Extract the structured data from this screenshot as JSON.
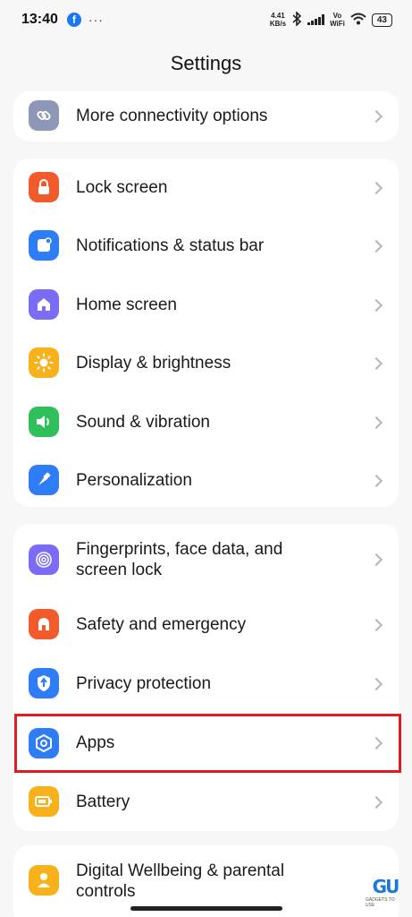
{
  "status_bar": {
    "time": "13:40",
    "fb_glyph": "f",
    "dots": "···",
    "speed_value": "4.41",
    "speed_unit": "KB/s",
    "vo": "Vo",
    "wifi_label": "WiFi",
    "battery": "43",
    "icons": [
      "facebook-icon",
      "bluetooth-icon",
      "signal-icon",
      "wifi-icon",
      "battery-icon"
    ]
  },
  "header": {
    "title": "Settings"
  },
  "groups": [
    {
      "items": [
        {
          "label": "More connectivity options",
          "icon": "link-icon",
          "color": "#8e97b5"
        }
      ]
    },
    {
      "items": [
        {
          "label": "Lock screen",
          "icon": "lock-icon",
          "color": "#f15a2b"
        },
        {
          "label": "Notifications & status bar",
          "icon": "notification-icon",
          "color": "#2f7df6"
        },
        {
          "label": "Home screen",
          "icon": "home-icon",
          "color": "#7b6cf6"
        },
        {
          "label": "Display & brightness",
          "icon": "sun-icon",
          "color": "#f7b21b"
        },
        {
          "label": "Sound & vibration",
          "icon": "speaker-icon",
          "color": "#2fc05c"
        },
        {
          "label": "Personalization",
          "icon": "brush-icon",
          "color": "#2f7df6"
        }
      ]
    },
    {
      "items": [
        {
          "label_line1": "Fingerprints, face data, and",
          "label_line2": "screen lock",
          "icon": "fingerprint-icon",
          "color": "#7b6cf6"
        },
        {
          "label": "Safety and emergency",
          "icon": "emergency-icon",
          "color": "#f15a2b"
        },
        {
          "label": "Privacy protection",
          "icon": "privacy-icon",
          "color": "#2f7df6"
        },
        {
          "label": "Apps",
          "icon": "apps-gear-icon",
          "color": "#2f7df6"
        },
        {
          "label": "Battery",
          "icon": "battery-setting-icon",
          "color": "#f7b21b"
        }
      ]
    },
    {
      "items": [
        {
          "label_line1": "Digital Wellbeing & parental",
          "label_line2": "controls",
          "icon": "wellbeing-icon",
          "color": "#f7b21b"
        }
      ]
    }
  ],
  "watermark": {
    "logo": "GU",
    "text": "GADGETS TO USE"
  }
}
